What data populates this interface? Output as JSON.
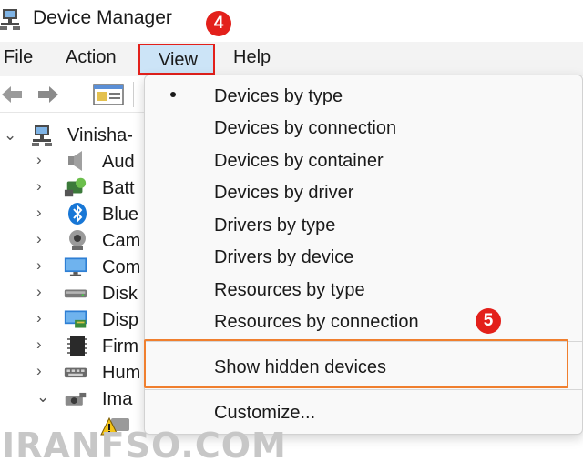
{
  "window": {
    "title": "Device Manager"
  },
  "badges": {
    "step_view": "4",
    "step_hidden": "5"
  },
  "menubar": {
    "items": [
      {
        "label": "File"
      },
      {
        "label": "Action"
      },
      {
        "label": "View"
      },
      {
        "label": "Help"
      }
    ]
  },
  "tree": {
    "root": "Vinisha-",
    "items": [
      {
        "label": "Aud",
        "icon": "speaker-icon"
      },
      {
        "label": "Batt",
        "icon": "battery-icon"
      },
      {
        "label": "Blue",
        "icon": "bluetooth-icon"
      },
      {
        "label": "Cam",
        "icon": "camera-icon"
      },
      {
        "label": "Com",
        "icon": "monitor-icon"
      },
      {
        "label": "Disk",
        "icon": "disk-drive-icon"
      },
      {
        "label": "Disp",
        "icon": "display-adapter-icon"
      },
      {
        "label": "Firm",
        "icon": "firmware-chip-icon"
      },
      {
        "label": "Hum",
        "icon": "keyboard-icon"
      },
      {
        "label": "Ima",
        "icon": "imaging-device-icon"
      }
    ]
  },
  "view_menu": {
    "items": [
      {
        "label": "Devices by type",
        "checked": true
      },
      {
        "label": "Devices by connection"
      },
      {
        "label": "Devices by container"
      },
      {
        "label": "Devices by driver"
      },
      {
        "label": "Drivers by type"
      },
      {
        "label": "Drivers by device"
      },
      {
        "label": "Resources by type"
      },
      {
        "label": "Resources by connection"
      }
    ],
    "show_hidden": "Show hidden devices",
    "customize": "Customize..."
  },
  "watermark": "IRANFSO.COM",
  "colors": {
    "annotation_red": "#e3201b",
    "annotation_orange": "#f07f2e",
    "menu_active": "#cce4f7"
  }
}
